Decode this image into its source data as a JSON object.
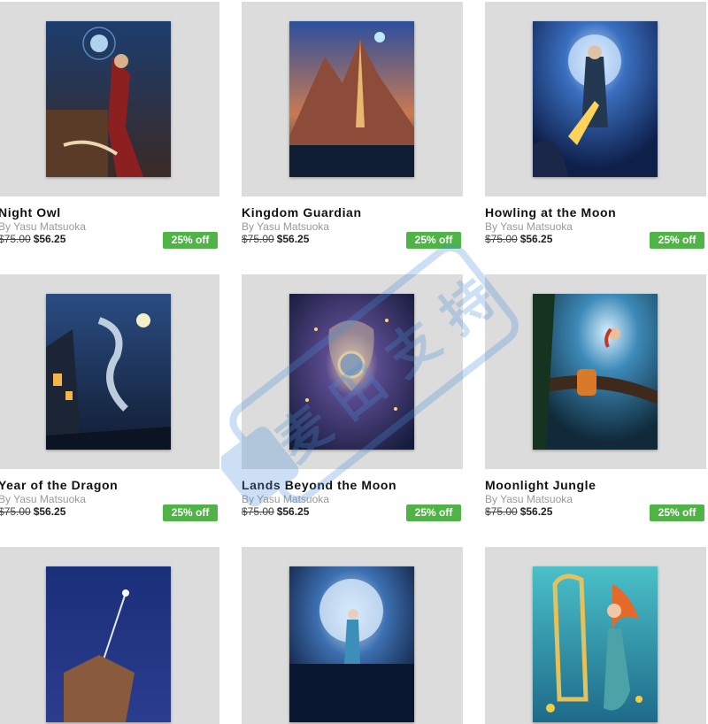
{
  "products": [
    {
      "title": "Night Owl",
      "artist": "By Yasu Matsuoka",
      "original_price": "$75.00",
      "sale_price": "$56.25",
      "discount": "25% off",
      "art_icon": "night-owl-artwork"
    },
    {
      "title": "Kingdom Guardian",
      "artist": "By Yasu Matsuoka",
      "original_price": "$75.00",
      "sale_price": "$56.25",
      "discount": "25% off",
      "art_icon": "kingdom-guardian-artwork"
    },
    {
      "title": "Howling at the Moon",
      "artist": "By Yasu Matsuoka",
      "original_price": "$75.00",
      "sale_price": "$56.25",
      "discount": "25% off",
      "art_icon": "howling-at-the-moon-artwork"
    },
    {
      "title": "Year of the Dragon",
      "artist": "By Yasu Matsuoka",
      "original_price": "$75.00",
      "sale_price": "$56.25",
      "discount": "25% off",
      "art_icon": "year-of-the-dragon-artwork"
    },
    {
      "title": "Lands Beyond the Moon",
      "artist": "By Yasu Matsuoka",
      "original_price": "$75.00",
      "sale_price": "$56.25",
      "discount": "25% off",
      "art_icon": "lands-beyond-the-moon-artwork"
    },
    {
      "title": "Moonlight Jungle",
      "artist": "By Yasu Matsuoka",
      "original_price": "$75.00",
      "sale_price": "$56.25",
      "discount": "25% off",
      "art_icon": "moonlight-jungle-artwork"
    },
    {
      "art_icon": "moon-staff-artwork"
    },
    {
      "art_icon": "mermaid-moon-artwork"
    },
    {
      "art_icon": "mermaid-harp-artwork"
    }
  ],
  "watermark": {
    "text": "麦 田 支 持",
    "color": "#4a90d9"
  },
  "colors": {
    "badge": "#4fb346",
    "card_background": "#dcdcdc"
  }
}
